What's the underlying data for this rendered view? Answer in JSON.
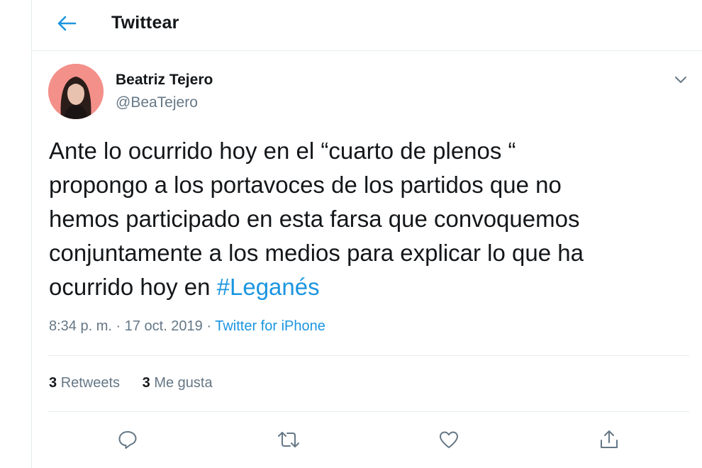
{
  "header": {
    "back_icon": "arrow-left-icon",
    "title": "Twittear"
  },
  "tweet": {
    "author_name": "Beatriz Tejero",
    "author_handle": "@BeaTejero",
    "text_lines": [
      "Ante lo ocurrido hoy en el “cuarto de plenos “",
      "propongo a los portavoces de los partidos que no",
      "hemos participado en esta farsa que convoquemos",
      "conjuntamente a los medios para explicar lo que ha",
      "ocurrido hoy en "
    ],
    "hashtag": "#Leganés",
    "timestamp": "8:34 p. m. · 17 oct. 2019 · ",
    "source": "Twitter for iPhone"
  },
  "stats": {
    "retweets_count": "3",
    "retweets_label": "Retweets",
    "likes_count": "3",
    "likes_label": "Me gusta"
  },
  "actions": {
    "reply_icon": "reply-icon",
    "retweet_icon": "retweet-icon",
    "like_icon": "heart-icon",
    "share_icon": "share-icon"
  },
  "colors": {
    "accent": "#1b95e0",
    "text": "#14171a",
    "secondary": "#657786",
    "border": "#e6ecf0",
    "avatar_bg": "#f4908a"
  }
}
